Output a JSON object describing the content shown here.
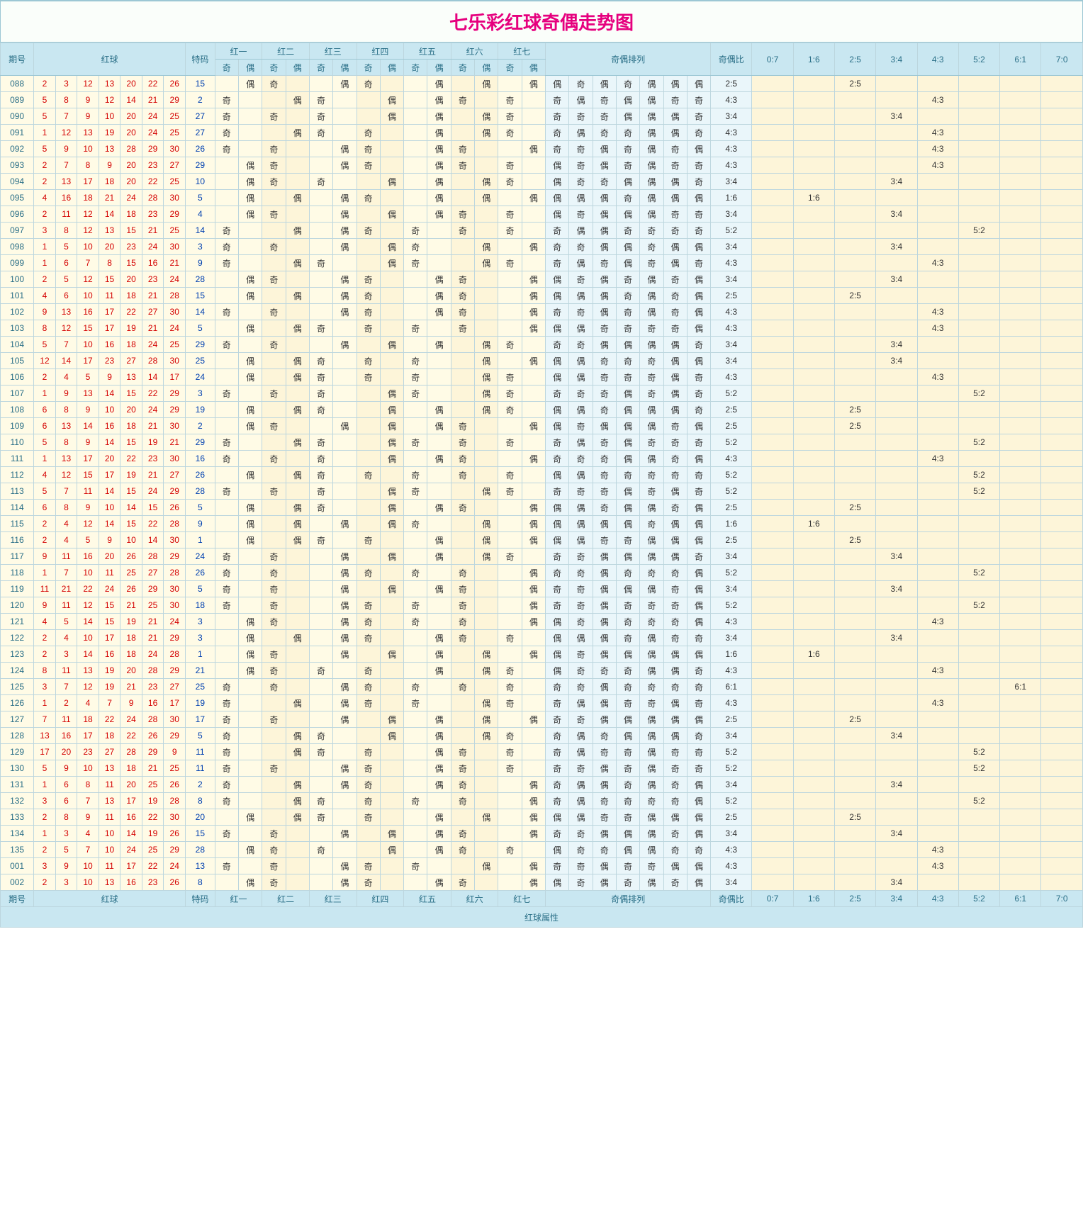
{
  "title": "七乐彩红球奇偶走势图",
  "labels": {
    "odd": "奇",
    "even": "偶"
  },
  "headers": {
    "period": "期号",
    "red": "红球",
    "special": "特码",
    "r1": "红一",
    "r2": "红二",
    "r3": "红三",
    "r4": "红四",
    "r5": "红五",
    "r6": "红六",
    "r7": "红七",
    "odd": "奇",
    "even": "偶",
    "arrangement": "奇偶排列",
    "ratio": "奇偶比",
    "ratios": [
      "0:7",
      "1:6",
      "2:5",
      "3:4",
      "4:3",
      "5:2",
      "6:1",
      "7:0"
    ],
    "attribute": "红球属性"
  },
  "chart_data": {
    "type": "table",
    "description": "七乐彩 red-ball odd/even trend. For each draw: period, 7 red balls, special number, odd/even of each position, odd:even ratio.",
    "rows": [
      {
        "period": "088",
        "red": [
          2,
          3,
          12,
          13,
          20,
          22,
          26
        ],
        "special": 15,
        "ratio": "2:5"
      },
      {
        "period": "089",
        "red": [
          5,
          8,
          9,
          12,
          14,
          21,
          29
        ],
        "special": 2,
        "ratio": "4:3"
      },
      {
        "period": "090",
        "red": [
          5,
          7,
          9,
          10,
          20,
          24,
          25
        ],
        "special": 27,
        "ratio": "3:4"
      },
      {
        "period": "091",
        "red": [
          1,
          12,
          13,
          19,
          20,
          24,
          25
        ],
        "special": 27,
        "ratio": "4:3"
      },
      {
        "period": "092",
        "red": [
          5,
          9,
          10,
          13,
          28,
          29,
          30
        ],
        "special": 26,
        "ratio": "4:3"
      },
      {
        "period": "093",
        "red": [
          2,
          7,
          8,
          9,
          20,
          23,
          27
        ],
        "special": 29,
        "ratio": "4:3"
      },
      {
        "period": "094",
        "red": [
          2,
          13,
          17,
          18,
          20,
          22,
          25
        ],
        "special": 10,
        "ratio": "3:4"
      },
      {
        "period": "095",
        "red": [
          4,
          16,
          18,
          21,
          24,
          28,
          30
        ],
        "special": 5,
        "ratio": "1:6"
      },
      {
        "period": "096",
        "red": [
          2,
          11,
          12,
          14,
          18,
          23,
          29
        ],
        "special": 4,
        "ratio": "3:4"
      },
      {
        "period": "097",
        "red": [
          3,
          8,
          12,
          13,
          15,
          21,
          25
        ],
        "special": 14,
        "ratio": "5:2"
      },
      {
        "period": "098",
        "red": [
          1,
          5,
          10,
          20,
          23,
          24,
          30
        ],
        "special": 3,
        "ratio": "3:4"
      },
      {
        "period": "099",
        "red": [
          1,
          6,
          7,
          8,
          15,
          16,
          21
        ],
        "special": 9,
        "ratio": "4:3"
      },
      {
        "period": "100",
        "red": [
          2,
          5,
          12,
          15,
          20,
          23,
          24
        ],
        "special": 28,
        "ratio": "3:4"
      },
      {
        "period": "101",
        "red": [
          4,
          6,
          10,
          11,
          18,
          21,
          28
        ],
        "special": 15,
        "ratio": "2:5"
      },
      {
        "period": "102",
        "red": [
          9,
          13,
          16,
          17,
          22,
          27,
          30
        ],
        "special": 14,
        "ratio": "4:3"
      },
      {
        "period": "103",
        "red": [
          8,
          12,
          15,
          17,
          19,
          21,
          24
        ],
        "special": 5,
        "ratio": "4:3"
      },
      {
        "period": "104",
        "red": [
          5,
          7,
          10,
          16,
          18,
          24,
          25
        ],
        "special": 29,
        "ratio": "3:4"
      },
      {
        "period": "105",
        "red": [
          12,
          14,
          17,
          23,
          27,
          28,
          30
        ],
        "special": 25,
        "ratio": "3:4"
      },
      {
        "period": "106",
        "red": [
          2,
          4,
          5,
          9,
          13,
          14,
          17
        ],
        "special": 24,
        "ratio": "4:3"
      },
      {
        "period": "107",
        "red": [
          1,
          9,
          13,
          14,
          15,
          22,
          29
        ],
        "special": 3,
        "ratio": "5:2"
      },
      {
        "period": "108",
        "red": [
          6,
          8,
          9,
          10,
          20,
          24,
          29
        ],
        "special": 19,
        "ratio": "2:5"
      },
      {
        "period": "109",
        "red": [
          6,
          13,
          14,
          16,
          18,
          21,
          30
        ],
        "special": 2,
        "ratio": "2:5"
      },
      {
        "period": "110",
        "red": [
          5,
          8,
          9,
          14,
          15,
          19,
          21
        ],
        "special": 29,
        "ratio": "5:2"
      },
      {
        "period": "111",
        "red": [
          1,
          13,
          17,
          20,
          22,
          23,
          30
        ],
        "special": 16,
        "ratio": "4:3"
      },
      {
        "period": "112",
        "red": [
          4,
          12,
          15,
          17,
          19,
          21,
          27
        ],
        "special": 26,
        "ratio": "5:2"
      },
      {
        "period": "113",
        "red": [
          5,
          7,
          11,
          14,
          15,
          24,
          29
        ],
        "special": 28,
        "ratio": "5:2"
      },
      {
        "period": "114",
        "red": [
          6,
          8,
          9,
          10,
          14,
          15,
          26
        ],
        "special": 5,
        "ratio": "2:5"
      },
      {
        "period": "115",
        "red": [
          2,
          4,
          12,
          14,
          15,
          22,
          28
        ],
        "special": 9,
        "ratio": "1:6"
      },
      {
        "period": "116",
        "red": [
          2,
          4,
          5,
          9,
          10,
          14,
          30
        ],
        "special": 1,
        "ratio": "2:5"
      },
      {
        "period": "117",
        "red": [
          9,
          11,
          16,
          20,
          26,
          28,
          29
        ],
        "special": 24,
        "ratio": "3:4"
      },
      {
        "period": "118",
        "red": [
          1,
          7,
          10,
          11,
          25,
          27,
          28
        ],
        "special": 26,
        "ratio": "5:2"
      },
      {
        "period": "119",
        "red": [
          11,
          21,
          22,
          24,
          26,
          29,
          30
        ],
        "special": 5,
        "ratio": "3:4"
      },
      {
        "period": "120",
        "red": [
          9,
          11,
          12,
          15,
          21,
          25,
          30
        ],
        "special": 18,
        "ratio": "5:2"
      },
      {
        "period": "121",
        "red": [
          4,
          5,
          14,
          15,
          19,
          21,
          24
        ],
        "special": 3,
        "ratio": "4:3"
      },
      {
        "period": "122",
        "red": [
          2,
          4,
          10,
          17,
          18,
          21,
          29
        ],
        "special": 3,
        "ratio": "3:4"
      },
      {
        "period": "123",
        "red": [
          2,
          3,
          14,
          16,
          18,
          24,
          28
        ],
        "special": 1,
        "ratio": "1:6"
      },
      {
        "period": "124",
        "red": [
          8,
          11,
          13,
          19,
          20,
          28,
          29
        ],
        "special": 21,
        "ratio": "4:3"
      },
      {
        "period": "125",
        "red": [
          3,
          7,
          12,
          19,
          21,
          23,
          27
        ],
        "special": 25,
        "ratio": "6:1"
      },
      {
        "period": "126",
        "red": [
          1,
          2,
          4,
          7,
          9,
          16,
          17
        ],
        "special": 19,
        "ratio": "4:3"
      },
      {
        "period": "127",
        "red": [
          7,
          11,
          18,
          22,
          24,
          28,
          30
        ],
        "special": 17,
        "ratio": "2:5"
      },
      {
        "period": "128",
        "red": [
          13,
          16,
          17,
          18,
          22,
          26,
          29
        ],
        "special": 5,
        "ratio": "3:4"
      },
      {
        "period": "129",
        "red": [
          17,
          20,
          23,
          27,
          28,
          29,
          9
        ],
        "special": 11,
        "ratio": "5:2"
      },
      {
        "period": "130",
        "red": [
          5,
          9,
          10,
          13,
          18,
          21,
          25
        ],
        "special": 11,
        "ratio": "5:2"
      },
      {
        "period": "131",
        "red": [
          1,
          6,
          8,
          11,
          20,
          25,
          26
        ],
        "special": 2,
        "ratio": "3:4"
      },
      {
        "period": "132",
        "red": [
          3,
          6,
          7,
          13,
          17,
          19,
          28
        ],
        "special": 8,
        "ratio": "5:2"
      },
      {
        "period": "133",
        "red": [
          2,
          8,
          9,
          11,
          16,
          22,
          30
        ],
        "special": 20,
        "ratio": "2:5"
      },
      {
        "period": "134",
        "red": [
          1,
          3,
          4,
          10,
          14,
          19,
          26
        ],
        "special": 15,
        "ratio": "3:4"
      },
      {
        "period": "135",
        "red": [
          2,
          5,
          7,
          10,
          24,
          25,
          29
        ],
        "special": 28,
        "ratio": "4:3"
      },
      {
        "period": "001",
        "red": [
          3,
          9,
          10,
          11,
          17,
          22,
          24
        ],
        "special": 13,
        "ratio": "4:3"
      },
      {
        "period": "002",
        "red": [
          2,
          3,
          10,
          13,
          16,
          23,
          26
        ],
        "special": 8,
        "ratio": "3:4"
      }
    ]
  }
}
